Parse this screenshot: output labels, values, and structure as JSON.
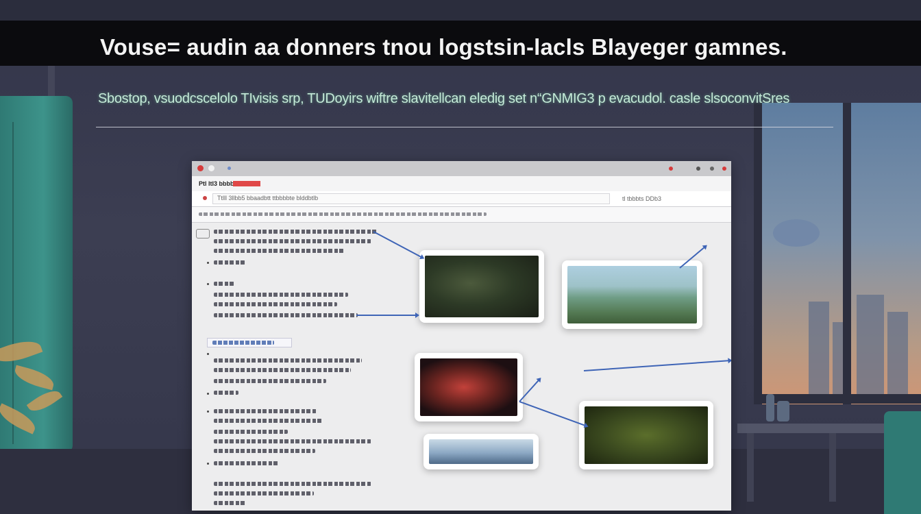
{
  "header": {
    "title": "Vouse= audin aa donners tnou logstsin-lacls Blayeger gamnes.",
    "subtitle": "Sbostop, vsuodcscelolo TIvisis srp, TUDoyirs wiftre slavitellcan eledig set n“GNMIG3 p evacudol. casle slsoconvitSres"
  },
  "browser": {
    "tab_label": "Ptl ltl3 bbbbtb",
    "address_text": "Ttlll 3llbb5 bbaadbtt ttbbbbte blddbtlb",
    "right_status": "tl tbbbts DDb3"
  },
  "images": [
    {
      "name": "forest-tree-image"
    },
    {
      "name": "coastal-landscape-image"
    },
    {
      "name": "red-game-box-image"
    },
    {
      "name": "jungle-foliage-image"
    },
    {
      "name": "snowy-mountains-image"
    }
  ],
  "colors": {
    "title_bar": "#0b0b0e",
    "subtitle_glow": "#7ee0b0",
    "connector": "#3e64b6",
    "close_dot": "#d63b3b"
  }
}
